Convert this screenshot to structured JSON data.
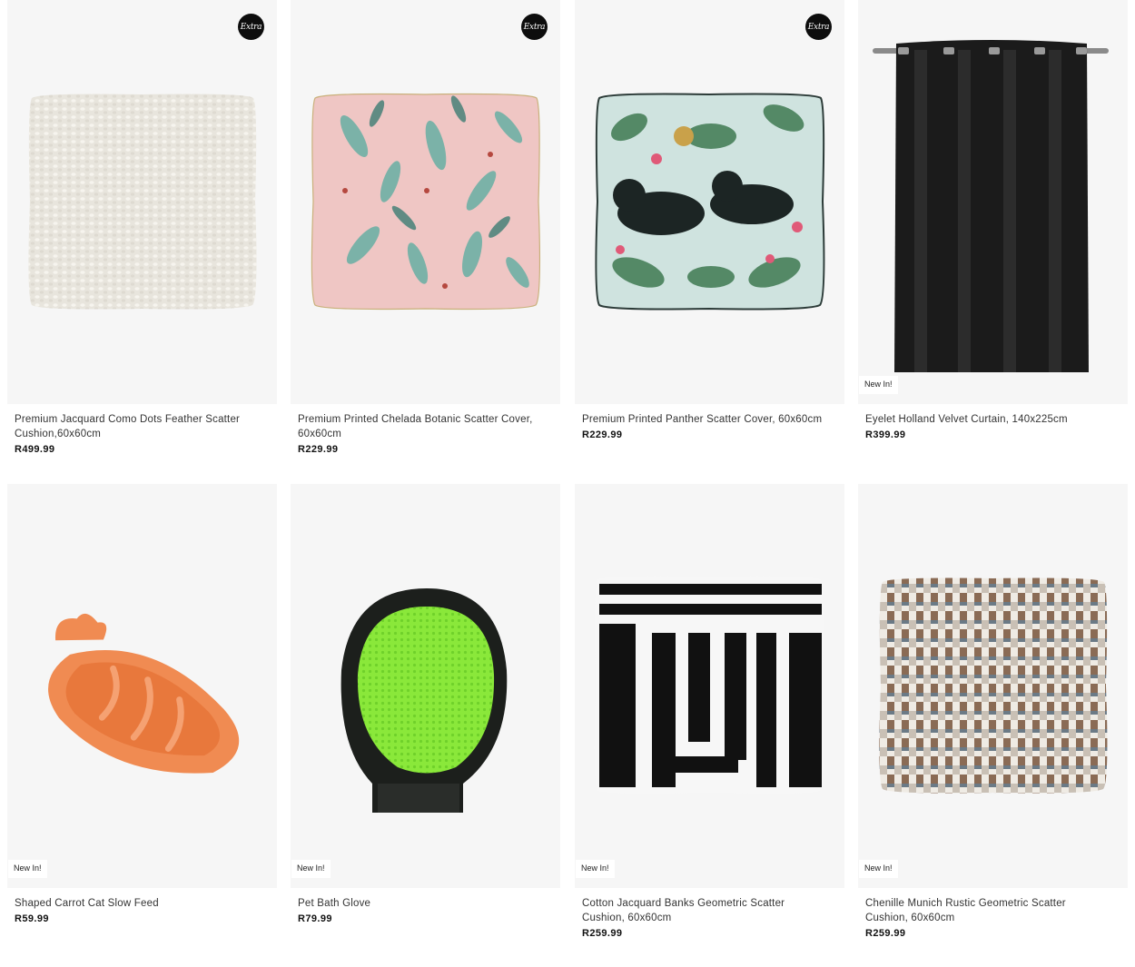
{
  "products": [
    {
      "name": "Premium Jacquard Como Dots Feather Scatter Cushion,60x60cm",
      "price": "R499.99",
      "badge": "Extra",
      "tag": ""
    },
    {
      "name": "Premium Printed Chelada Botanic Scatter Cover, 60x60cm",
      "price": "R229.99",
      "badge": "Extra",
      "tag": ""
    },
    {
      "name": "Premium Printed Panther Scatter Cover, 60x60cm",
      "price": "R229.99",
      "badge": "Extra",
      "tag": ""
    },
    {
      "name": "Eyelet Holland Velvet Curtain, 140x225cm",
      "price": "R399.99",
      "badge": "",
      "tag": "New In!"
    },
    {
      "name": "Shaped Carrot Cat Slow Feed",
      "price": "R59.99",
      "badge": "",
      "tag": "New In!"
    },
    {
      "name": "Pet Bath Glove",
      "price": "R79.99",
      "badge": "",
      "tag": "New In!"
    },
    {
      "name": "Cotton Jacquard Banks Geometric Scatter Cushion, 60x60cm",
      "price": "R259.99",
      "badge": "",
      "tag": "New In!"
    },
    {
      "name": "Chenille Munich Rustic Geometric Scatter Cushion, 60x60cm",
      "price": "R259.99",
      "badge": "",
      "tag": "New In!"
    }
  ],
  "colors": {
    "image_bg": "#f6f6f6",
    "badge_bg": "#0d0d0d",
    "price_text": "#111111"
  },
  "images": [
    "cream-cushion-image",
    "pink-botanic-cushion-image",
    "panther-cushion-image",
    "black-curtain-image",
    "orange-carrot-bowl-image",
    "green-bath-glove-image",
    "black-white-geometric-cushion-image",
    "brown-checked-cushion-image"
  ]
}
